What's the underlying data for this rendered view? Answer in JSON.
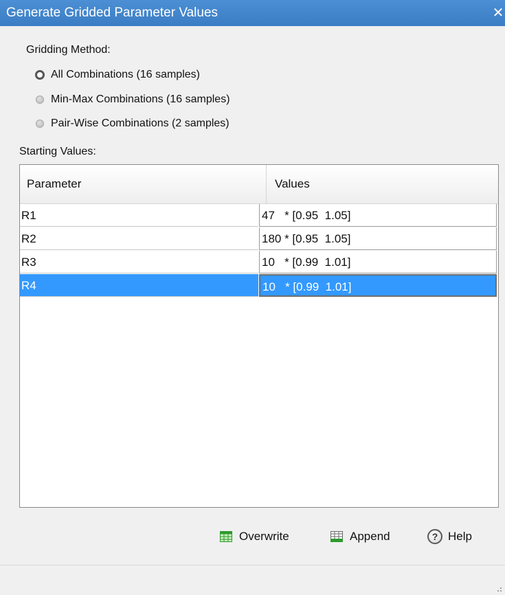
{
  "window": {
    "title": "Generate Gridded Parameter Values",
    "close_glyph": "✕"
  },
  "gridding": {
    "label": "Gridding Method:",
    "options": [
      {
        "label": "All Combinations (16 samples)",
        "checked": true
      },
      {
        "label": "Min-Max Combinations (16 samples)",
        "checked": false
      },
      {
        "label": "Pair-Wise Combinations (2 samples)",
        "checked": false
      }
    ]
  },
  "starting_values": {
    "label": "Starting Values:",
    "columns": [
      "Parameter",
      "Values"
    ],
    "rows": [
      {
        "parameter": "R1",
        "values": "47   * [0.95  1.05]",
        "selected": false
      },
      {
        "parameter": "R2",
        "values": "180 * [0.95  1.05]",
        "selected": false
      },
      {
        "parameter": "R3",
        "values": "10   * [0.99  1.01]",
        "selected": false
      },
      {
        "parameter": "R4",
        "values": "10   * [0.99  1.01]",
        "selected": true
      }
    ]
  },
  "buttons": {
    "overwrite": "Overwrite",
    "append": "Append",
    "help": "Help",
    "help_glyph": "?"
  },
  "icons": {
    "overwrite": "table-overwrite-icon",
    "append": "table-append-icon",
    "help": "help-icon",
    "resize": "resize-grip-icon"
  },
  "colors": {
    "titlebar": "#3b7dc4",
    "selection": "#3399ff",
    "grid_icon": "#2e9a2e"
  }
}
